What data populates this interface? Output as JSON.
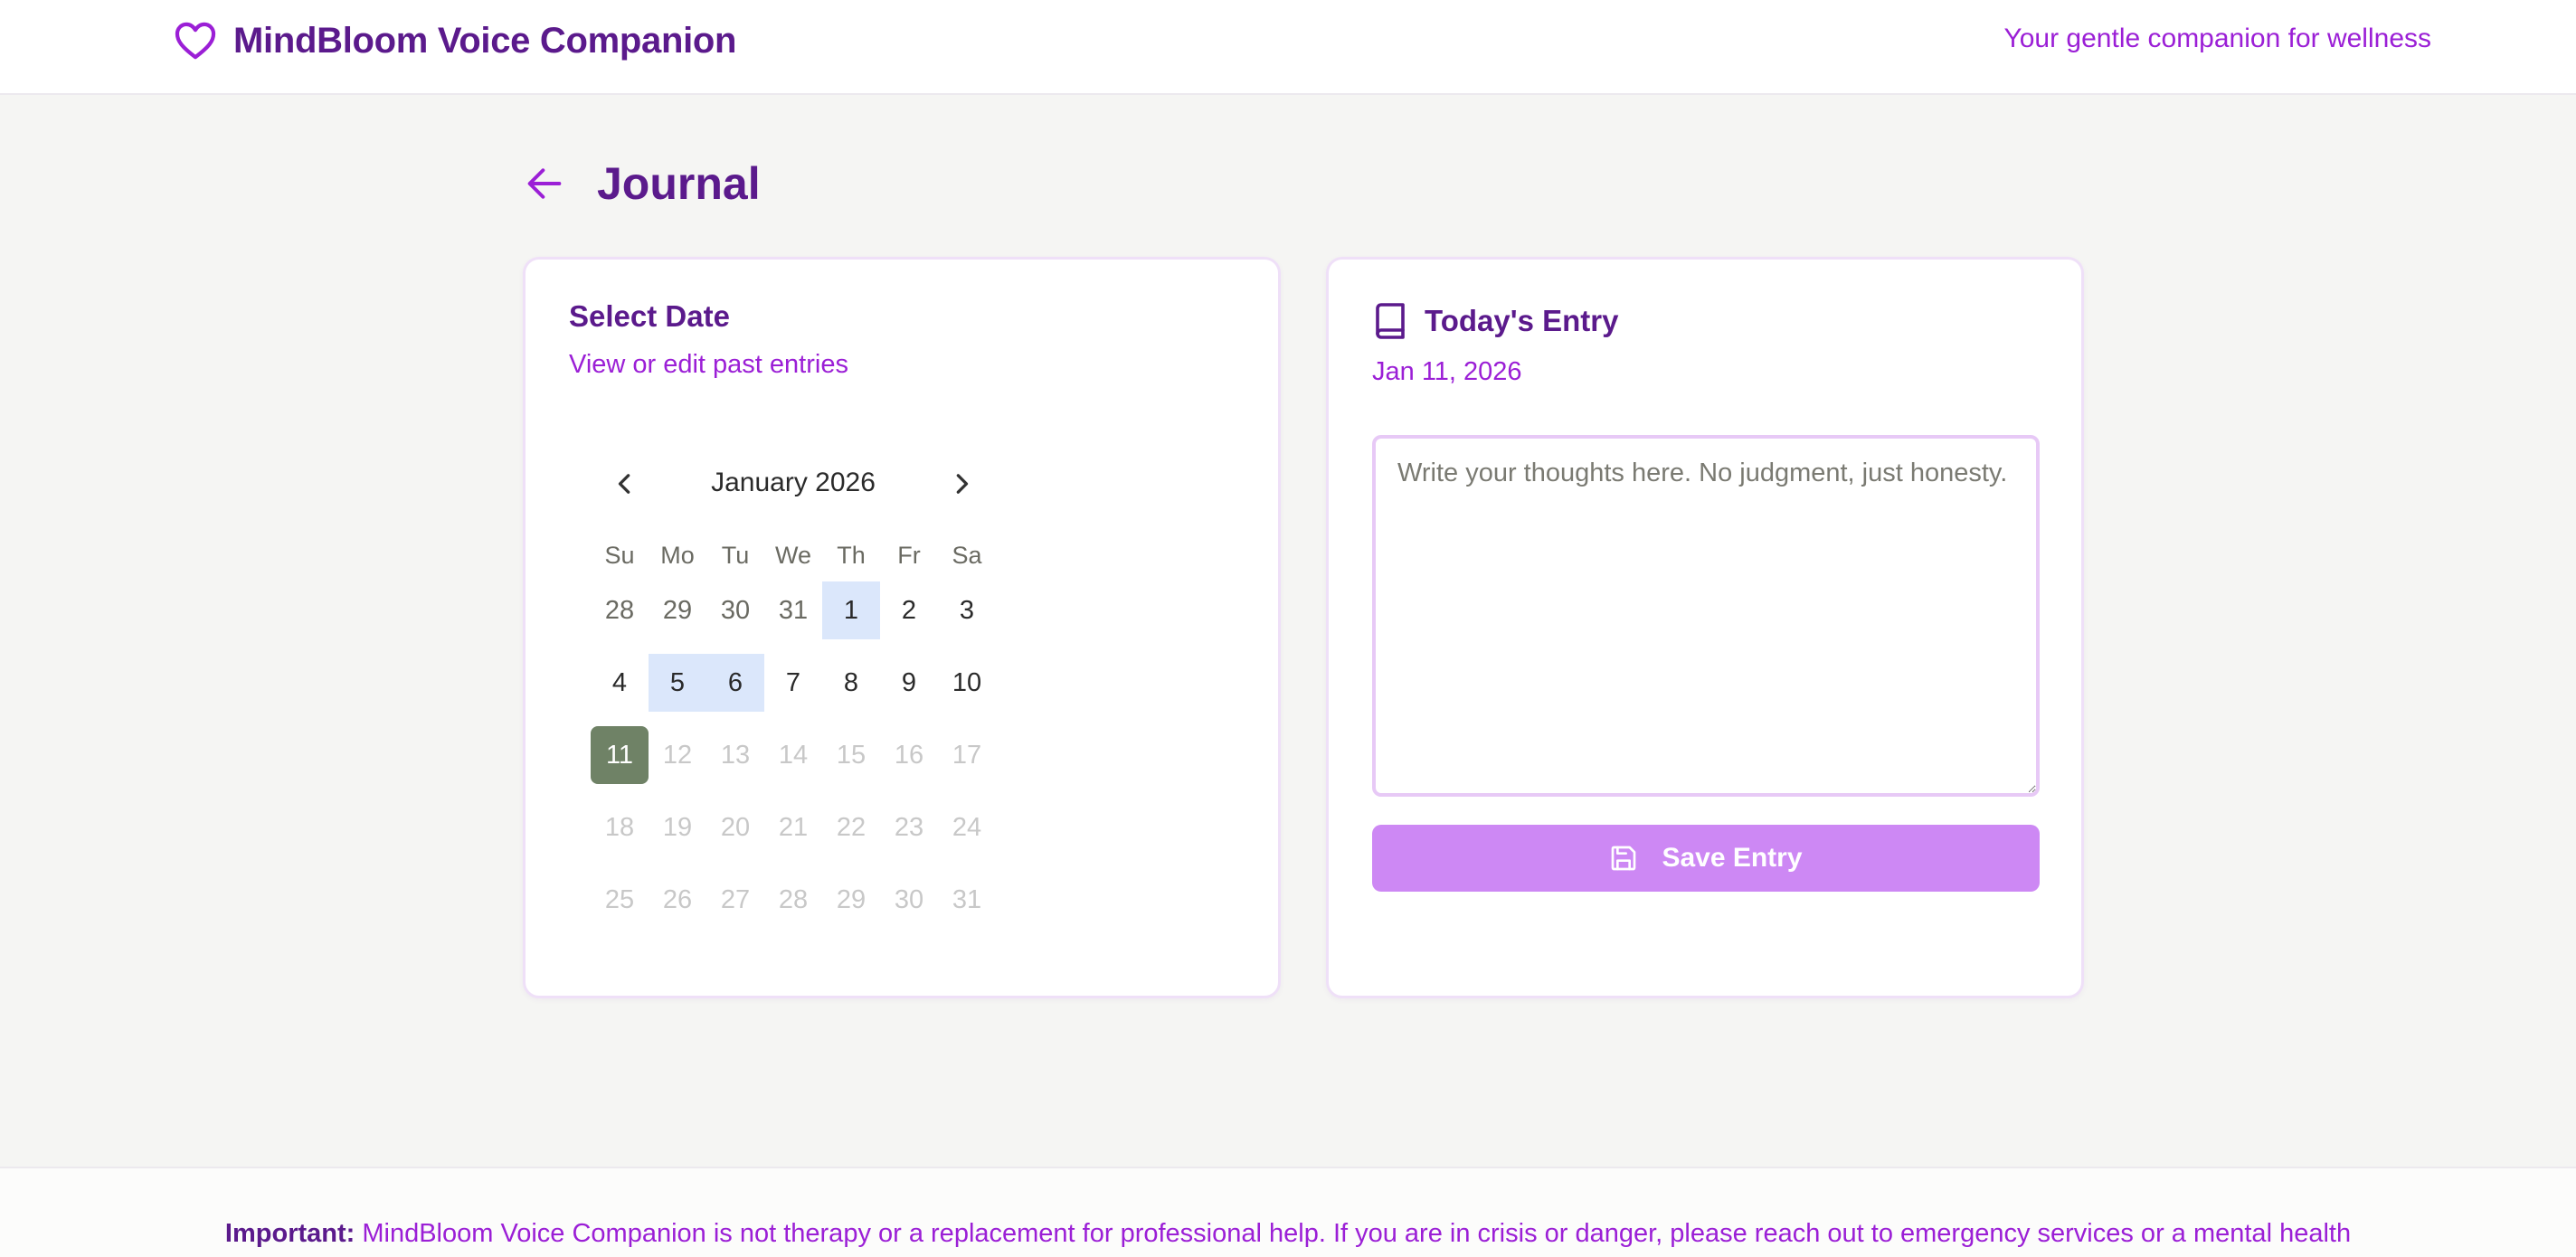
{
  "header": {
    "brand_title": "MindBloom Voice Companion",
    "tagline": "Your gentle companion for wellness",
    "brand_icon": "heart-icon"
  },
  "page": {
    "title": "Journal",
    "back_icon": "arrow-left-icon"
  },
  "date_card": {
    "heading": "Select Date",
    "subheading": "View or edit past entries"
  },
  "calendar": {
    "caption": "January 2026",
    "prev_icon": "chevron-left-icon",
    "next_icon": "chevron-right-icon",
    "weekdays": [
      "Su",
      "Mo",
      "Tu",
      "We",
      "Th",
      "Fr",
      "Sa"
    ],
    "days": [
      {
        "label": "28",
        "state": "outside"
      },
      {
        "label": "29",
        "state": "outside"
      },
      {
        "label": "30",
        "state": "outside"
      },
      {
        "label": "31",
        "state": "outside"
      },
      {
        "label": "1",
        "state": "has-entry"
      },
      {
        "label": "2",
        "state": "normal"
      },
      {
        "label": "3",
        "state": "normal"
      },
      {
        "label": "4",
        "state": "normal"
      },
      {
        "label": "5",
        "state": "has-entry"
      },
      {
        "label": "6",
        "state": "has-entry"
      },
      {
        "label": "7",
        "state": "normal"
      },
      {
        "label": "8",
        "state": "normal"
      },
      {
        "label": "9",
        "state": "normal"
      },
      {
        "label": "10",
        "state": "normal"
      },
      {
        "label": "11",
        "state": "selected"
      },
      {
        "label": "12",
        "state": "muted"
      },
      {
        "label": "13",
        "state": "muted"
      },
      {
        "label": "14",
        "state": "muted"
      },
      {
        "label": "15",
        "state": "muted"
      },
      {
        "label": "16",
        "state": "muted"
      },
      {
        "label": "17",
        "state": "muted"
      },
      {
        "label": "18",
        "state": "muted"
      },
      {
        "label": "19",
        "state": "muted"
      },
      {
        "label": "20",
        "state": "muted"
      },
      {
        "label": "21",
        "state": "muted"
      },
      {
        "label": "22",
        "state": "muted"
      },
      {
        "label": "23",
        "state": "muted"
      },
      {
        "label": "24",
        "state": "muted"
      },
      {
        "label": "25",
        "state": "muted"
      },
      {
        "label": "26",
        "state": "muted"
      },
      {
        "label": "27",
        "state": "muted"
      },
      {
        "label": "28",
        "state": "muted"
      },
      {
        "label": "29",
        "state": "muted"
      },
      {
        "label": "30",
        "state": "muted"
      },
      {
        "label": "31",
        "state": "muted"
      }
    ]
  },
  "entry_card": {
    "heading": "Today's Entry",
    "book_icon": "book-icon",
    "date": "Jan 11, 2026",
    "textarea_value": "",
    "textarea_placeholder": "Write your thoughts here. No judgment, just honesty.",
    "save_label": "Save Entry",
    "save_icon": "save-icon"
  },
  "footer": {
    "important_label": "Important:",
    "notice": "MindBloom Voice Companion is not therapy or a replacement for professional help. If you are in crisis or danger, please reach out to emergency services or a mental health"
  },
  "colors": {
    "primary_dark": "#5b1a8c",
    "accent": "#9b1fd6",
    "save_button": "#cd88f4",
    "selected_day": "#6f8266",
    "entry_day": "#dbe7fb",
    "background": "#f5f5f3"
  }
}
